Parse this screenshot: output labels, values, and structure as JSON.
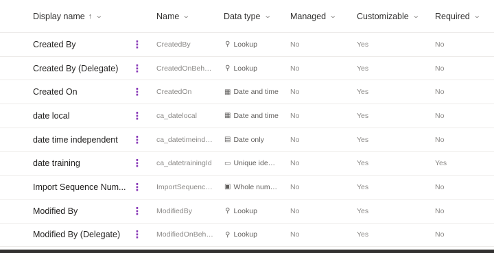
{
  "header": {
    "display_name": "Display name",
    "name": "Name",
    "data_type": "Data type",
    "managed": "Managed",
    "customizable": "Customizable",
    "required": "Required"
  },
  "rows": [
    {
      "display": "Created By",
      "name": "CreatedBy",
      "type_icon": "magnifier-icon",
      "type_glyph": "⚲",
      "type": "Lookup",
      "managed": "No",
      "customizable": "Yes",
      "required": "No"
    },
    {
      "display": "Created By (Delegate)",
      "name": "CreatedOnBehalf...",
      "type_icon": "magnifier-icon",
      "type_glyph": "⚲",
      "type": "Lookup",
      "managed": "No",
      "customizable": "Yes",
      "required": "No"
    },
    {
      "display": "Created On",
      "name": "CreatedOn",
      "type_icon": "calendar-clock-icon",
      "type_glyph": "▦",
      "type": "Date and time",
      "managed": "No",
      "customizable": "Yes",
      "required": "No"
    },
    {
      "display": "date local",
      "name": "ca_datelocal",
      "type_icon": "calendar-clock-icon",
      "type_glyph": "▦",
      "type": "Date and time",
      "managed": "No",
      "customizable": "Yes",
      "required": "No"
    },
    {
      "display": "date time independent",
      "name": "ca_datetimeinde...",
      "type_icon": "calendar-icon",
      "type_glyph": "▤",
      "type": "Date only",
      "managed": "No",
      "customizable": "Yes",
      "required": "No"
    },
    {
      "display": "date training",
      "name": "ca_datetrainingId",
      "type_icon": "id-card-icon",
      "type_glyph": "▭",
      "type": "Unique identifie",
      "managed": "No",
      "customizable": "Yes",
      "required": "Yes"
    },
    {
      "display": "Import Sequence Num...",
      "name": "ImportSequence...",
      "type_icon": "number-icon",
      "type_glyph": "▣",
      "type": "Whole number",
      "managed": "No",
      "customizable": "Yes",
      "required": "No"
    },
    {
      "display": "Modified By",
      "name": "ModifiedBy",
      "type_icon": "magnifier-icon",
      "type_glyph": "⚲",
      "type": "Lookup",
      "managed": "No",
      "customizable": "Yes",
      "required": "No"
    },
    {
      "display": "Modified By (Delegate)",
      "name": "ModifiedOnBeha...",
      "type_icon": "magnifier-icon",
      "type_glyph": "⚲",
      "type": "Lookup",
      "managed": "No",
      "customizable": "Yes",
      "required": "No"
    }
  ],
  "icons": {
    "sort_up": "↑",
    "chevron_down": "⌄",
    "more": "⋮"
  },
  "colors": {
    "more_accent": "#8a3bb8",
    "border": "#edebe9"
  }
}
